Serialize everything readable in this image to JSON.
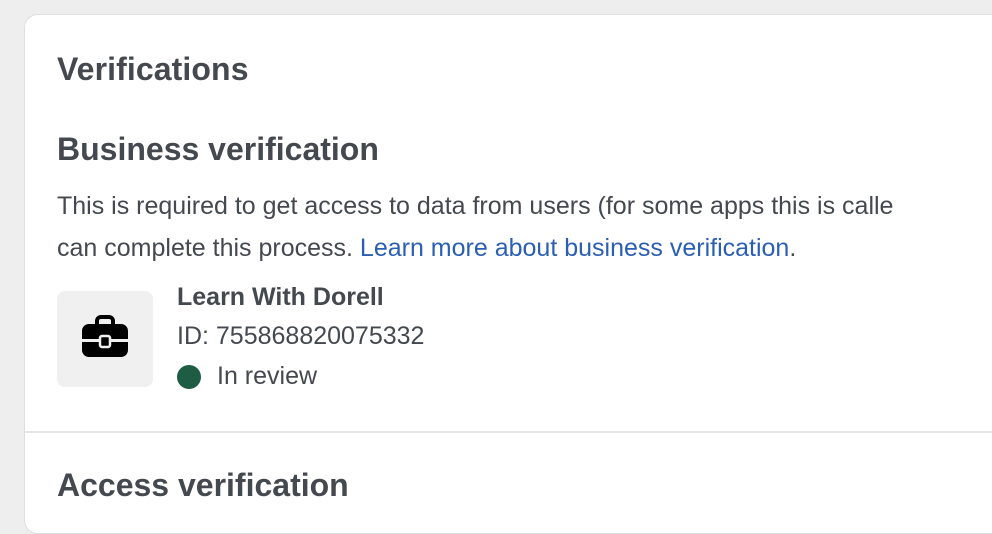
{
  "verifications": {
    "title": "Verifications"
  },
  "business_verification": {
    "title": "Business verification",
    "description_line1": "This is required to get access to data from users (for some apps this is calle",
    "description_line2_prefix": "can complete this process. ",
    "learn_more_link": "Learn more about business verification",
    "description_line2_suffix": ".",
    "business": {
      "icon": "briefcase-icon",
      "name": "Learn With Dorell",
      "id": "ID: 755868820075332",
      "status": "In review",
      "status_color": "#1f5c44"
    }
  },
  "access_verification": {
    "title": "Access verification"
  }
}
